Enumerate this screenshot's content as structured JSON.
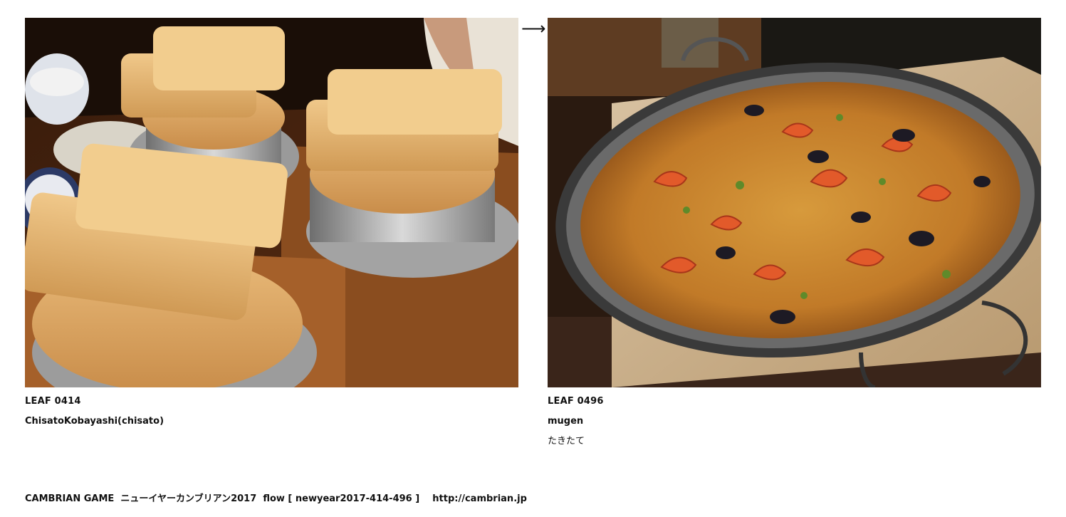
{
  "leaves": [
    {
      "id": "LEAF 0414",
      "author": "ChisatoKobayashi(chisato)",
      "title": "",
      "image": "photo of wooden-lidded rice pots (kamameshi) on a restaurant table"
    },
    {
      "id": "LEAF 0496",
      "author": "mugen",
      "title": "たきたて",
      "image": "photo of a large seafood paella pan with shrimp and mussels"
    }
  ],
  "arrow": "⟶",
  "footer": {
    "site": "CAMBRIAN GAME",
    "event": "ニューイヤーカンブリアン2017",
    "flow_label": "flow [ newyear2017-414-496 ]",
    "url": "http://cambrian.jp"
  },
  "colors": {
    "background": "#ffffff",
    "text": "#111111"
  }
}
